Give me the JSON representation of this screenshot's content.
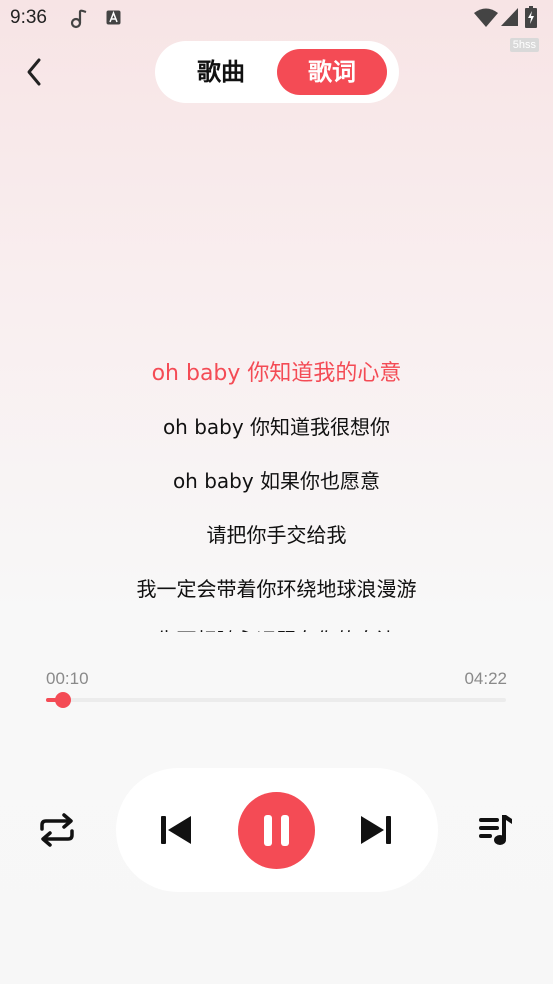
{
  "status_bar": {
    "time": "9:36",
    "watermark": "5hss"
  },
  "header": {
    "tabs": [
      {
        "label": "歌曲",
        "selected": false
      },
      {
        "label": "歌词",
        "selected": true
      }
    ]
  },
  "lyrics": {
    "lines": [
      "oh baby  你知道我的心意",
      "oh baby 你知道我很想你",
      "oh baby 如果你也愿意",
      "请把你手交给我",
      "我一定会带着你环绕地球浪漫游",
      "生死相随永远跟在你的身边"
    ],
    "active_index": 0
  },
  "player": {
    "current_time": "00:10",
    "total_time": "04:22",
    "progress": 0.038
  },
  "icons": {
    "back": "chevron-left-icon",
    "repeat": "repeat-icon",
    "previous": "skip-previous-icon",
    "pause": "pause-icon",
    "next": "skip-next-icon",
    "playlist": "playlist-music-icon"
  },
  "colors": {
    "accent": "#f44b55"
  }
}
